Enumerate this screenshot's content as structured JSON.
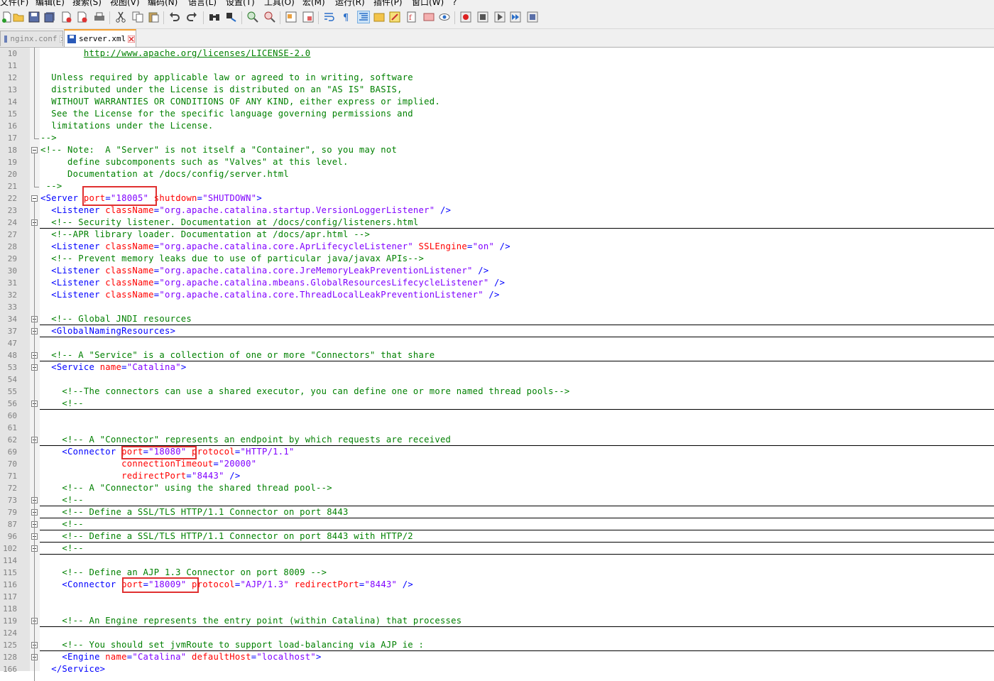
{
  "menu": [
    "文件(F)",
    "编辑(E)",
    "搜索(S)",
    "视图(V)",
    "编码(N)",
    "语言(L)",
    "设置(T)",
    "工具(O)",
    "宏(M)",
    "运行(R)",
    "插件(P)",
    "窗口(W)",
    "?"
  ],
  "tabs": [
    {
      "label": "nginx.conf",
      "active": false
    },
    {
      "label": "server.xml",
      "active": true
    }
  ],
  "colors": {
    "comment": "#008000",
    "tag": "#0000ff",
    "attr": "#ff0000",
    "value": "#8000ff",
    "highlight": "#e03030"
  },
  "lines": [
    {
      "n": "10",
      "fold": "none",
      "seg": [
        {
          "t": "        "
        },
        {
          "t": "http://www.apache.org/licenses/LICENSE-2.0",
          "c": "url"
        }
      ]
    },
    {
      "n": "11",
      "fold": "none",
      "seg": [
        {
          "t": ""
        }
      ]
    },
    {
      "n": "12",
      "fold": "none",
      "seg": [
        {
          "t": "  Unless required by applicable law or agreed to in writing, software",
          "c": "cm"
        }
      ]
    },
    {
      "n": "13",
      "fold": "none",
      "seg": [
        {
          "t": "  distributed under the License is distributed on an \"AS IS\" BASIS,",
          "c": "cm"
        }
      ]
    },
    {
      "n": "14",
      "fold": "none",
      "seg": [
        {
          "t": "  WITHOUT WARRANTIES OR CONDITIONS OF ANY KIND, either express or implied.",
          "c": "cm"
        }
      ]
    },
    {
      "n": "15",
      "fold": "none",
      "seg": [
        {
          "t": "  See the License for the specific language governing permissions and",
          "c": "cm"
        }
      ]
    },
    {
      "n": "16",
      "fold": "none",
      "seg": [
        {
          "t": "  limitations under the License.",
          "c": "cm"
        }
      ]
    },
    {
      "n": "17",
      "fold": "end",
      "seg": [
        {
          "t": "-->",
          "c": "cm"
        }
      ]
    },
    {
      "n": "18",
      "fold": "minus",
      "seg": [
        {
          "t": "<!-- Note:  A \"Server\" is not itself a \"Container\", so you may not",
          "c": "cm"
        }
      ]
    },
    {
      "n": "19",
      "fold": "none",
      "seg": [
        {
          "t": "     define subcomponents such as \"Valves\" at this level.",
          "c": "cm"
        }
      ]
    },
    {
      "n": "20",
      "fold": "none",
      "seg": [
        {
          "t": "     Documentation at /docs/config/server.html",
          "c": "cm"
        }
      ]
    },
    {
      "n": "21",
      "fold": "end",
      "seg": [
        {
          "t": " -->",
          "c": "cm"
        }
      ]
    },
    {
      "n": "22",
      "fold": "minus",
      "seg": [
        {
          "t": "<Server ",
          "c": "tag"
        },
        {
          "t": "port",
          "c": "attr"
        },
        {
          "t": "=",
          "c": "tag"
        },
        {
          "t": "\"18005\"",
          "c": "val"
        },
        {
          "t": " "
        },
        {
          "t": "shutdown",
          "c": "attr"
        },
        {
          "t": "=",
          "c": "tag"
        },
        {
          "t": "\"SHUTDOWN\"",
          "c": "val"
        },
        {
          "t": ">",
          "c": "tag"
        }
      ]
    },
    {
      "n": "23",
      "fold": "none",
      "seg": [
        {
          "t": "  <Listener ",
          "c": "tag"
        },
        {
          "t": "className",
          "c": "attr"
        },
        {
          "t": "=",
          "c": "tag"
        },
        {
          "t": "\"org.apache.catalina.startup.VersionLoggerListener\"",
          "c": "val"
        },
        {
          "t": " />",
          "c": "tag"
        }
      ]
    },
    {
      "n": "24",
      "fold": "plus",
      "seg": [
        {
          "t": "  <!-- Security listener. Documentation at /docs/config/listeners.html",
          "c": "cm"
        }
      ]
    },
    {
      "n": "27",
      "fold": "none",
      "seg": [
        {
          "t": "  <!--APR library loader. Documentation at /docs/apr.html -->",
          "c": "cm"
        }
      ]
    },
    {
      "n": "28",
      "fold": "none",
      "seg": [
        {
          "t": "  <Listener ",
          "c": "tag"
        },
        {
          "t": "className",
          "c": "attr"
        },
        {
          "t": "=",
          "c": "tag"
        },
        {
          "t": "\"org.apache.catalina.core.AprLifecycleListener\"",
          "c": "val"
        },
        {
          "t": " "
        },
        {
          "t": "SSLEngine",
          "c": "attr"
        },
        {
          "t": "=",
          "c": "tag"
        },
        {
          "t": "\"on\"",
          "c": "val"
        },
        {
          "t": " />",
          "c": "tag"
        }
      ]
    },
    {
      "n": "29",
      "fold": "none",
      "seg": [
        {
          "t": "  <!-- Prevent memory leaks due to use of particular java/javax APIs-->",
          "c": "cm"
        }
      ]
    },
    {
      "n": "30",
      "fold": "none",
      "seg": [
        {
          "t": "  <Listener ",
          "c": "tag"
        },
        {
          "t": "className",
          "c": "attr"
        },
        {
          "t": "=",
          "c": "tag"
        },
        {
          "t": "\"org.apache.catalina.core.JreMemoryLeakPreventionListener\"",
          "c": "val"
        },
        {
          "t": " />",
          "c": "tag"
        }
      ]
    },
    {
      "n": "31",
      "fold": "none",
      "seg": [
        {
          "t": "  <Listener ",
          "c": "tag"
        },
        {
          "t": "className",
          "c": "attr"
        },
        {
          "t": "=",
          "c": "tag"
        },
        {
          "t": "\"org.apache.catalina.mbeans.GlobalResourcesLifecycleListener\"",
          "c": "val"
        },
        {
          "t": " />",
          "c": "tag"
        }
      ]
    },
    {
      "n": "32",
      "fold": "none",
      "seg": [
        {
          "t": "  <Listener ",
          "c": "tag"
        },
        {
          "t": "className",
          "c": "attr"
        },
        {
          "t": "=",
          "c": "tag"
        },
        {
          "t": "\"org.apache.catalina.core.ThreadLocalLeakPreventionListener\"",
          "c": "val"
        },
        {
          "t": " />",
          "c": "tag"
        }
      ]
    },
    {
      "n": "33",
      "fold": "none",
      "seg": [
        {
          "t": ""
        }
      ]
    },
    {
      "n": "34",
      "fold": "plus",
      "seg": [
        {
          "t": "  <!-- Global JNDI resources",
          "c": "cm"
        }
      ]
    },
    {
      "n": "37",
      "fold": "plus",
      "seg": [
        {
          "t": "  <GlobalNamingResources>",
          "c": "tag"
        }
      ]
    },
    {
      "n": "47",
      "fold": "none",
      "seg": [
        {
          "t": ""
        }
      ]
    },
    {
      "n": "48",
      "fold": "plus",
      "seg": [
        {
          "t": "  <!-- A \"Service\" is a collection of one or more \"Connectors\" that share",
          "c": "cm"
        }
      ]
    },
    {
      "n": "53",
      "fold": "minus",
      "seg": [
        {
          "t": "  <Service ",
          "c": "tag"
        },
        {
          "t": "name",
          "c": "attr"
        },
        {
          "t": "=",
          "c": "tag"
        },
        {
          "t": "\"Catalina\"",
          "c": "val"
        },
        {
          "t": ">",
          "c": "tag"
        }
      ]
    },
    {
      "n": "54",
      "fold": "none",
      "seg": [
        {
          "t": ""
        }
      ]
    },
    {
      "n": "55",
      "fold": "none",
      "seg": [
        {
          "t": "    <!--The connectors can use a shared executor, you can define one or more named thread pools-->",
          "c": "cm"
        }
      ]
    },
    {
      "n": "56",
      "fold": "plus",
      "seg": [
        {
          "t": "    <!--",
          "c": "cm"
        }
      ]
    },
    {
      "n": "60",
      "fold": "none",
      "seg": [
        {
          "t": ""
        }
      ]
    },
    {
      "n": "61",
      "fold": "none",
      "seg": [
        {
          "t": ""
        }
      ]
    },
    {
      "n": "62",
      "fold": "plus",
      "seg": [
        {
          "t": "    <!-- A \"Connector\" represents an endpoint by which requests are received",
          "c": "cm"
        }
      ]
    },
    {
      "n": "69",
      "fold": "none",
      "seg": [
        {
          "t": "    <Connector ",
          "c": "tag"
        },
        {
          "t": "port",
          "c": "attr"
        },
        {
          "t": "=",
          "c": "tag"
        },
        {
          "t": "\"18080\"",
          "c": "val"
        },
        {
          "t": " "
        },
        {
          "t": "protocol",
          "c": "attr"
        },
        {
          "t": "=",
          "c": "tag"
        },
        {
          "t": "\"HTTP/1.1\"",
          "c": "val"
        }
      ]
    },
    {
      "n": "70",
      "fold": "none",
      "seg": [
        {
          "t": "               "
        },
        {
          "t": "connectionTimeout",
          "c": "attr"
        },
        {
          "t": "=",
          "c": "tag"
        },
        {
          "t": "\"20000\"",
          "c": "val"
        }
      ]
    },
    {
      "n": "71",
      "fold": "none",
      "seg": [
        {
          "t": "               "
        },
        {
          "t": "redirectPort",
          "c": "attr"
        },
        {
          "t": "=",
          "c": "tag"
        },
        {
          "t": "\"8443\"",
          "c": "val"
        },
        {
          "t": " />",
          "c": "tag"
        }
      ]
    },
    {
      "n": "72",
      "fold": "none",
      "seg": [
        {
          "t": "    <!-- A \"Connector\" using the shared thread pool-->",
          "c": "cm"
        }
      ]
    },
    {
      "n": "73",
      "fold": "plus",
      "seg": [
        {
          "t": "    <!--",
          "c": "cm"
        }
      ]
    },
    {
      "n": "79",
      "fold": "plus",
      "seg": [
        {
          "t": "    <!-- Define a SSL/TLS HTTP/1.1 Connector on port 8443",
          "c": "cm"
        }
      ]
    },
    {
      "n": "87",
      "fold": "plus",
      "seg": [
        {
          "t": "    <!--",
          "c": "cm"
        }
      ]
    },
    {
      "n": "96",
      "fold": "plus",
      "seg": [
        {
          "t": "    <!-- Define a SSL/TLS HTTP/1.1 Connector on port 8443 with HTTP/2",
          "c": "cm"
        }
      ]
    },
    {
      "n": "102",
      "fold": "plus",
      "seg": [
        {
          "t": "    <!--",
          "c": "cm"
        }
      ]
    },
    {
      "n": "114",
      "fold": "none",
      "seg": [
        {
          "t": ""
        }
      ]
    },
    {
      "n": "115",
      "fold": "none",
      "seg": [
        {
          "t": "    <!-- Define an AJP 1.3 Connector on port 8009 -->",
          "c": "cm"
        }
      ]
    },
    {
      "n": "116",
      "fold": "none",
      "seg": [
        {
          "t": "    <Connector ",
          "c": "tag"
        },
        {
          "t": "port",
          "c": "attr"
        },
        {
          "t": "=",
          "c": "tag"
        },
        {
          "t": "\"18009\"",
          "c": "val"
        },
        {
          "t": " "
        },
        {
          "t": "protocol",
          "c": "attr"
        },
        {
          "t": "=",
          "c": "tag"
        },
        {
          "t": "\"AJP/1.3\"",
          "c": "val"
        },
        {
          "t": " "
        },
        {
          "t": "redirectPort",
          "c": "attr"
        },
        {
          "t": "=",
          "c": "tag"
        },
        {
          "t": "\"8443\"",
          "c": "val"
        },
        {
          "t": " />",
          "c": "tag"
        }
      ]
    },
    {
      "n": "117",
      "fold": "none",
      "seg": [
        {
          "t": ""
        }
      ]
    },
    {
      "n": "118",
      "fold": "none",
      "seg": [
        {
          "t": ""
        }
      ]
    },
    {
      "n": "119",
      "fold": "plus",
      "seg": [
        {
          "t": "    <!-- An Engine represents the entry point (within Catalina) that processes",
          "c": "cm"
        }
      ]
    },
    {
      "n": "124",
      "fold": "none",
      "seg": [
        {
          "t": ""
        }
      ]
    },
    {
      "n": "125",
      "fold": "plus",
      "seg": [
        {
          "t": "    <!-- You should set jvmRoute to support load-balancing via AJP ie :",
          "c": "cm"
        }
      ]
    },
    {
      "n": "128",
      "fold": "minus",
      "seg": [
        {
          "t": "    <Engine ",
          "c": "tag"
        },
        {
          "t": "name",
          "c": "attr"
        },
        {
          "t": "=",
          "c": "tag"
        },
        {
          "t": "\"Catalina\"",
          "c": "val"
        },
        {
          "t": " "
        },
        {
          "t": "defaultHost",
          "c": "attr"
        },
        {
          "t": "=",
          "c": "tag"
        },
        {
          "t": "\"localhost\"",
          "c": "val"
        },
        {
          "t": ">",
          "c": "tag"
        }
      ]
    },
    {
      "n": "166",
      "fold": "none",
      "seg": [
        {
          "t": "  </Service>",
          "c": "tag"
        }
      ]
    }
  ]
}
